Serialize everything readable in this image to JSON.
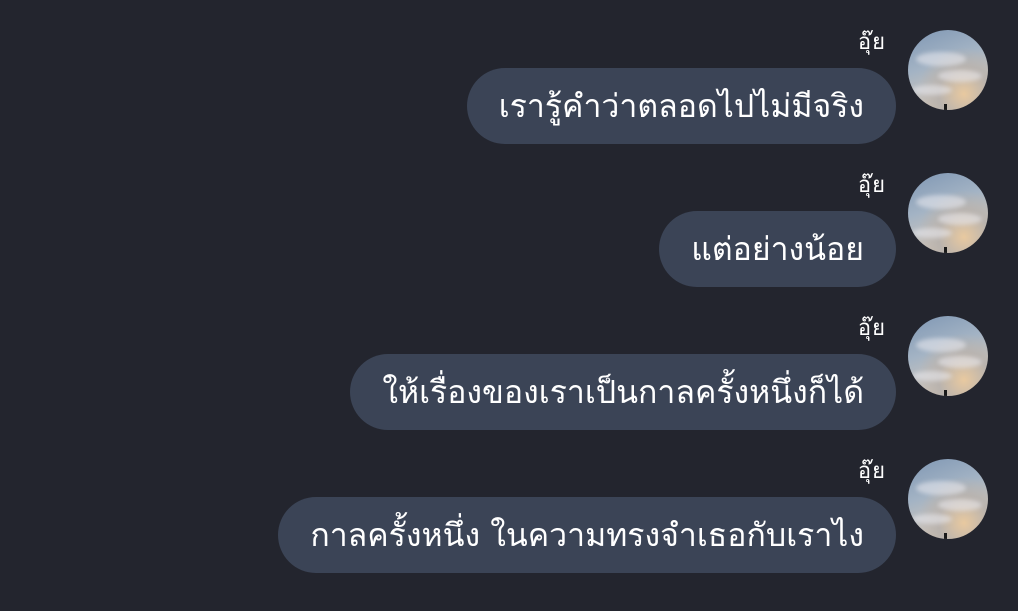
{
  "messages": [
    {
      "sender": "อุ๊ย",
      "text": "เรารู้คำว่าตลอดไปไม่มีจริง"
    },
    {
      "sender": "อุ๊ย",
      "text": "แต่อย่างน้อย"
    },
    {
      "sender": "อุ๊ย",
      "text": "ให้เรื่องของเราเป็นกาลครั้งหนึ่งก็ได้"
    },
    {
      "sender": "อุ๊ย",
      "text": "กาลครั้งหนึ่ง ในความทรงจำเธอกับเราไง"
    }
  ],
  "avatar": {
    "icon": "sky-photo-avatar"
  },
  "colors": {
    "background": "#23252e",
    "bubble": "#3b4456",
    "text": "#ffffff"
  }
}
